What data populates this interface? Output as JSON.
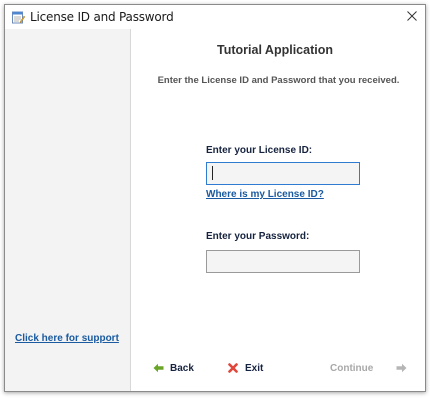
{
  "window": {
    "title": "License ID and Password"
  },
  "sidebar": {
    "support_link": "Click here for support"
  },
  "main": {
    "app_title": "Tutorial Application",
    "subtitle": "Enter the License ID and Password that you received.",
    "license_label": "Enter your License ID:",
    "license_value": "",
    "where_link": "Where is my License ID?",
    "password_label": "Enter your Password:",
    "password_value": ""
  },
  "footer": {
    "back_label": "Back",
    "exit_label": "Exit",
    "continue_label": "Continue"
  },
  "colors": {
    "link": "#1a5aa0",
    "back_arrow": "#6aa52a",
    "exit_x": "#e0463a",
    "disabled": "#a8a8a8",
    "input_focus_border": "#2f7bd1"
  },
  "icons": {
    "title": "notepad-icon",
    "close": "close-icon",
    "back": "arrow-left-icon",
    "exit": "x-icon",
    "continue": "arrow-right-icon"
  }
}
